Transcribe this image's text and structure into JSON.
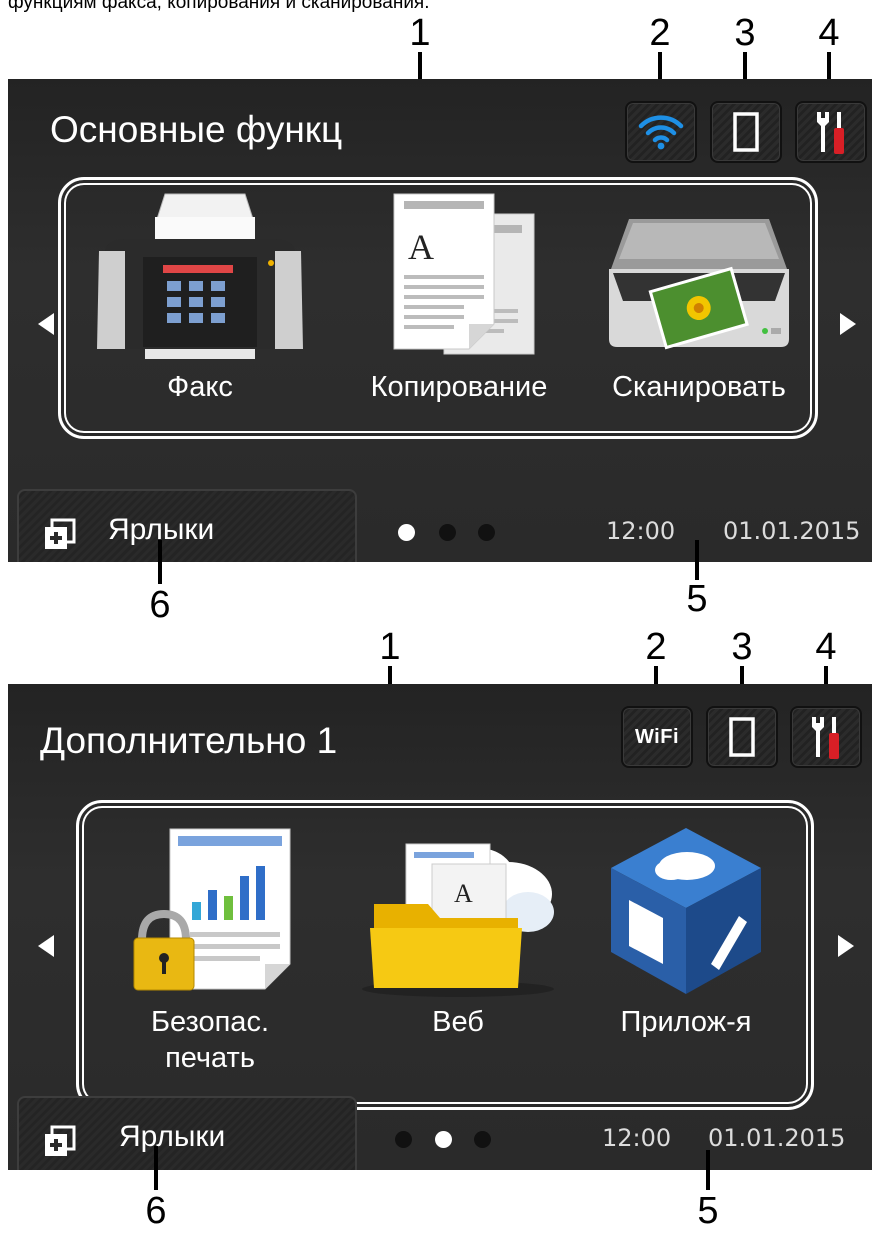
{
  "caption": "функциям факса, копирования и сканирования.",
  "colors": {
    "wifi_active": "#1e90e6",
    "screen_bg": "#2a2a2a",
    "tool_red": "#d81f26"
  },
  "callouts": {
    "n1": "1",
    "n2": "2",
    "n3": "3",
    "n4": "4",
    "n5": "5",
    "n6": "6"
  },
  "screen1": {
    "title": "Основные функц",
    "status": {
      "wifi_icon": "wifi-signal-icon",
      "toner_icon": "toner-icon",
      "settings_icon": "settings-tools-icon"
    },
    "apps": [
      {
        "label": "Факс",
        "icon": "fax-icon"
      },
      {
        "label": "Копирование",
        "icon": "copy-icon"
      },
      {
        "label": "Сканировать",
        "icon": "scanner-icon"
      }
    ],
    "shortcuts_label": "Ярлыки",
    "page_dots_active": 0,
    "time": "12:00",
    "date": "01.01.2015"
  },
  "screen2": {
    "title": "Дополнительно 1",
    "status": {
      "wifi_label": "WiFi",
      "toner_icon": "toner-icon",
      "settings_icon": "settings-tools-icon"
    },
    "apps": [
      {
        "label_line1": "Безопас.",
        "label_line2": "печать",
        "icon": "secure-print-icon"
      },
      {
        "label": "Веб",
        "icon": "web-folder-icon"
      },
      {
        "label": "Прилож-я",
        "icon": "apps-cube-icon"
      }
    ],
    "shortcuts_label": "Ярлыки",
    "page_dots_active": 1,
    "time": "12:00",
    "date": "01.01.2015"
  }
}
